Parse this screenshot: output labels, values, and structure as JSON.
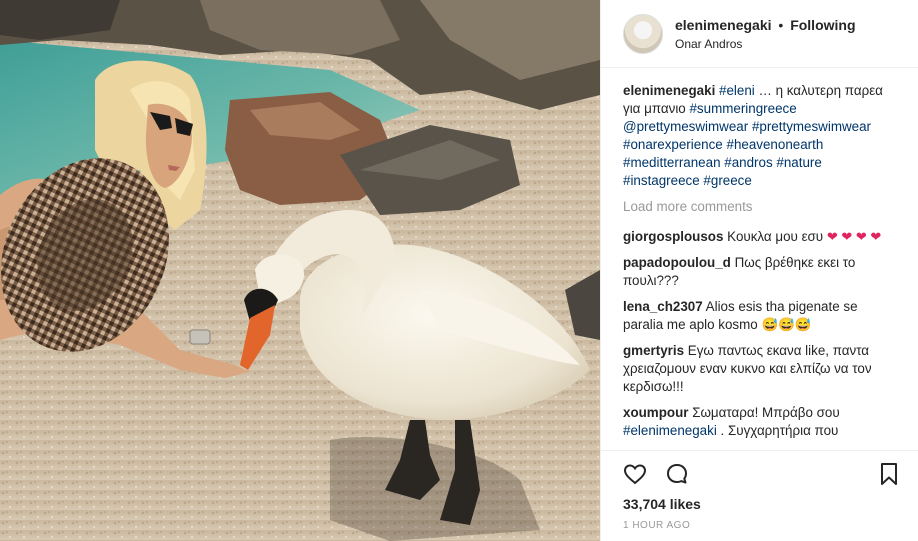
{
  "post": {
    "username": "elenimenegaki",
    "follow_sep": "•",
    "follow_state": "Following",
    "location": "Onar Andros"
  },
  "caption": {
    "username": "elenimenegaki",
    "tag1": "#eleni",
    "text1": " … η καλυτερη παρεα για μπανιο ",
    "tag2": "#summeringreece",
    "mention1": "@prettymeswimwear",
    "tag3": "#prettymeswimwear",
    "tag4": "#onarexperience",
    "tag5": "#heavenonearth",
    "tag6": "#meditterranean",
    "tag7": "#andros",
    "tag8": "#nature",
    "tag9": "#instagreece",
    "tag10": "#greece"
  },
  "load_more": "Load more comments",
  "comments": [
    {
      "user": "giorgosplousos",
      "text": "Κουκλα μου εσυ",
      "hearts": "❤ ❤ ❤ ❤"
    },
    {
      "user": "papadopoulou_d",
      "text": "Πως βρέθηκε εκει το πουλι???"
    },
    {
      "user": "lena_ch2307",
      "text": "Alios esis tha pigenate se paralia me aplo kosmo",
      "emoji": "😅😅😅"
    },
    {
      "user": "gmertyris",
      "text": "Εγω παντως εκανα like, παντα χρειαζομουν εναν κυκνο και ελπίζω να τον κερδισω!!!"
    },
    {
      "user": "xoumpour",
      "text": "Σωματαρα! Μπράβο σου ",
      "tag": "#elenimenegaki",
      "text2": " . Συγχαρητήρια που"
    }
  ],
  "likes": "33,704 likes",
  "time": "1 HOUR AGO",
  "icons": {
    "like": "heart-outline-icon",
    "comment": "comment-bubble-icon",
    "save": "bookmark-icon"
  }
}
